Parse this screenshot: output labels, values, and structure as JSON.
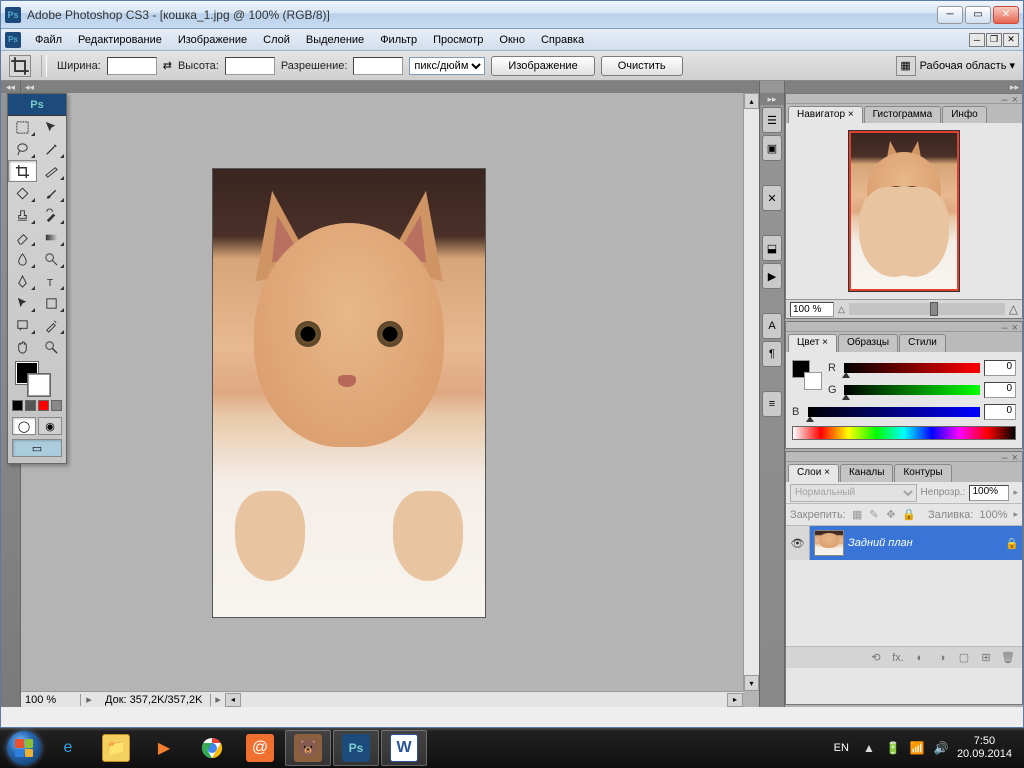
{
  "app": {
    "title": "Adobe Photoshop CS3 - [кошка_1.jpg @ 100% (RGB/8)]",
    "logo": "Ps"
  },
  "menubar": {
    "items": [
      "Файл",
      "Редактирование",
      "Изображение",
      "Слой",
      "Выделение",
      "Фильтр",
      "Просмотр",
      "Окно",
      "Справка"
    ]
  },
  "optionsbar": {
    "width_label": "Ширина:",
    "width_value": "",
    "height_label": "Высота:",
    "height_value": "",
    "resolution_label": "Разрешение:",
    "resolution_value": "",
    "units": "пикс/дюйм",
    "image_btn": "Изображение",
    "clear_btn": "Очистить",
    "workspace_label": "Рабочая область ▾"
  },
  "canvas": {
    "zoom": "100 %",
    "docsize": "Док: 357,2K/357,2K"
  },
  "panels": {
    "navigator": {
      "tabs": [
        "Навигатор ×",
        "Гистограмма",
        "Инфо"
      ],
      "zoom": "100 %"
    },
    "color": {
      "tabs": [
        "Цвет ×",
        "Образцы",
        "Стили"
      ],
      "r_label": "R",
      "r_value": "0",
      "g_label": "G",
      "g_value": "0",
      "b_label": "B",
      "b_value": "0"
    },
    "layers": {
      "tabs": [
        "Слои ×",
        "Каналы",
        "Контуры"
      ],
      "blend_mode": "Нормальный",
      "opacity_label": "Непрозр.:",
      "opacity_value": "100%",
      "lock_label": "Закрепить:",
      "fill_label": "Заливка:",
      "fill_value": "100%",
      "layer_name": "Задний план"
    }
  },
  "taskbar": {
    "lang": "EN",
    "time": "7:50",
    "date": "20.09.2014"
  }
}
